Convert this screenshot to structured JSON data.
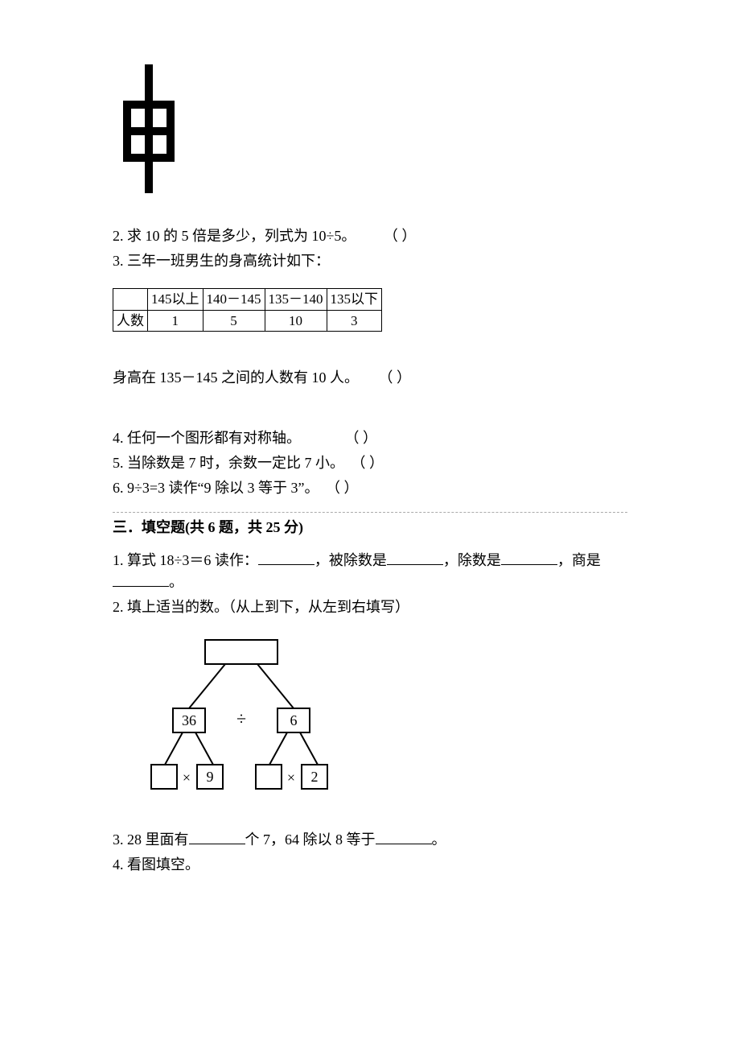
{
  "shen_label": "申",
  "q2": {
    "text": "2. 求 10 的 5 倍是多少，列式为 10÷5。",
    "paren": "（      ）"
  },
  "q3": {
    "text": "3. 三年一班男生的身高统计如下：",
    "table_headers": [
      "",
      "145以上",
      "140－145",
      "135－140",
      "135以下"
    ],
    "table_row_label": "人数",
    "table_values": [
      "1",
      "5",
      "10",
      "3"
    ],
    "statement": "身高在 135－145 之间的人数有 10 人。",
    "paren": "（      ）"
  },
  "q4": {
    "text": "4. 任何一个图形都有对称轴。",
    "paren": "（      ）"
  },
  "q5": {
    "text": "5. 当除数是 7 时，余数一定比 7 小。",
    "paren": "（      ）"
  },
  "q6": {
    "text": "6. 9÷3=3 读作“9 除以 3 等于 3”。",
    "paren": "（      ）"
  },
  "section3": {
    "title": "三．填空题(共 6 题，共 25 分)"
  },
  "f1": {
    "prefix": "1. 算式 18÷3＝6 读作：",
    "part2": "，被除数是",
    "part3": "，除数是",
    "part4": "，商是",
    "suffix": "。"
  },
  "f2": {
    "text": "2. 填上适当的数。（从上到下，从左到右填写）",
    "tree": {
      "div": "÷",
      "v36": "36",
      "v6": "6",
      "v9": "9",
      "v2": "2",
      "mul": "×"
    }
  },
  "f3": {
    "prefix": "3. 28 里面有",
    "mid": "个 7，64 除以 8 等于",
    "suffix": "。"
  },
  "f4": {
    "text": "4. 看图填空。"
  }
}
